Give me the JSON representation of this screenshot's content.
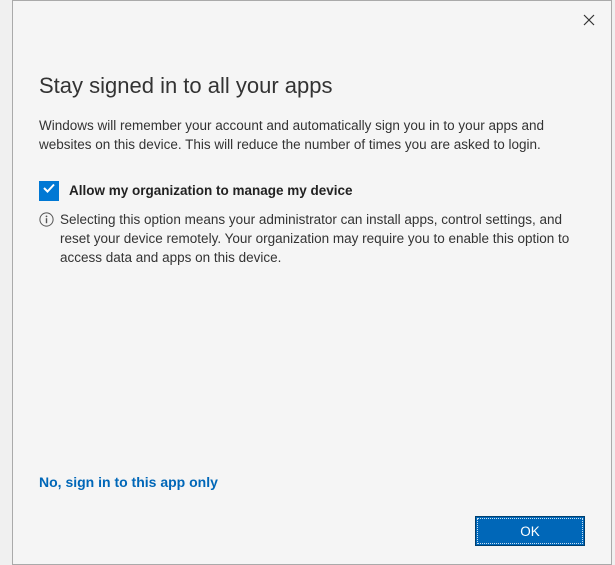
{
  "dialog": {
    "title": "Stay signed in to all your apps",
    "description": "Windows will remember your account and automatically sign you in to your apps and websites on this device. This will reduce the number of times you are asked to login.",
    "checkbox": {
      "checked": true,
      "label": "Allow my organization to manage my device"
    },
    "info_text": "Selecting this option means your administrator can install apps, control settings, and reset your device remotely. Your organization may require you to enable this option to access data and apps on this device.",
    "link_text": "No, sign in to this app only",
    "ok_label": "OK"
  }
}
